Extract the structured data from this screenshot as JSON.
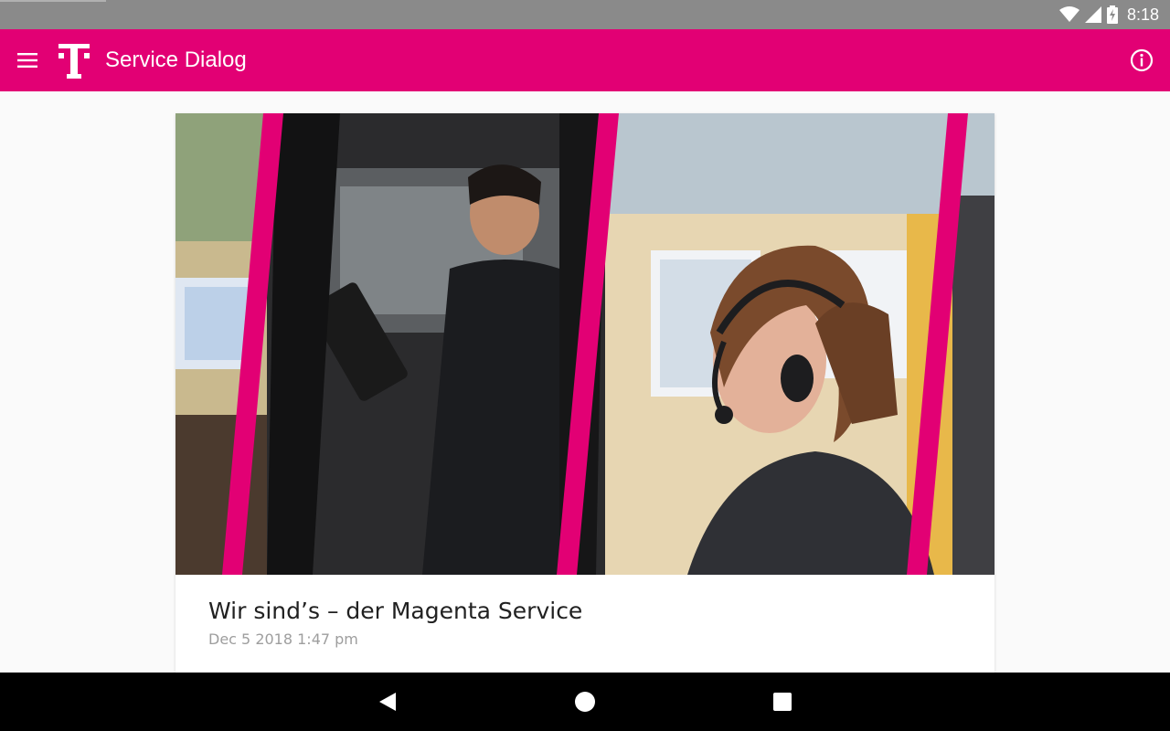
{
  "status_bar": {
    "time": "8:18",
    "icons": [
      "wifi-icon",
      "signal-icon",
      "battery-charging-icon"
    ]
  },
  "app_bar": {
    "title": "Service Dialog",
    "menu_icon": "menu-icon",
    "logo": "telekom-t-logo",
    "info_icon": "info-icon"
  },
  "colors": {
    "brand_magenta": "#e20074",
    "status_bar": "#8a8a8a",
    "background": "#fafafa",
    "nav_bar": "#000000"
  },
  "article": {
    "image": "magenta-service-hero-image",
    "title": "Wir sind’s – der Magenta Service",
    "date": "Dec 5 2018 1:47 pm"
  },
  "nav_bar": {
    "buttons": [
      "back-icon",
      "home-icon",
      "recents-icon"
    ]
  }
}
